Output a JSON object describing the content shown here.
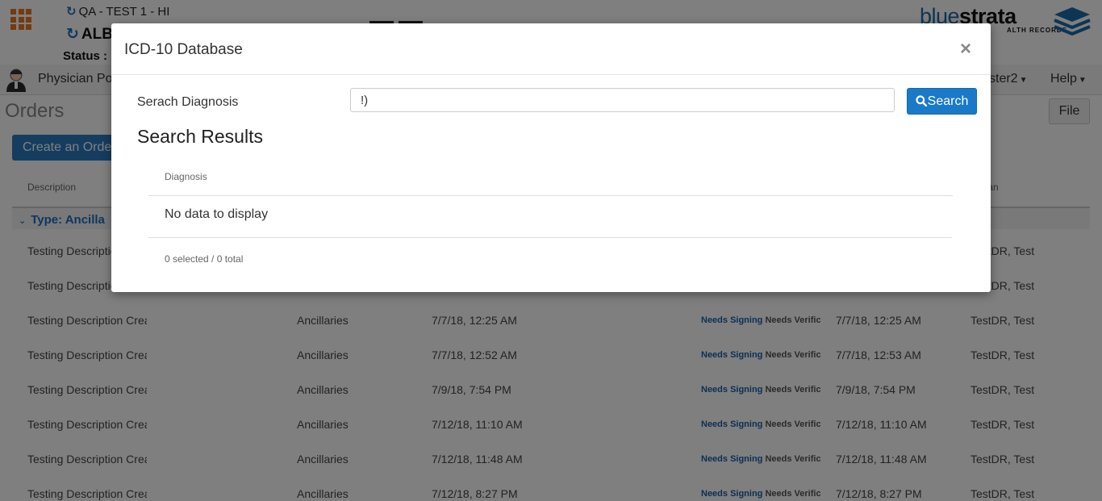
{
  "header": {
    "facility": "QA - TEST 1 - HI",
    "patient_name": "ALB",
    "status_label": "Status :",
    "logo": {
      "blue": "blue",
      "strata": "strata",
      "sub": "ALTH RECORDS"
    }
  },
  "nav": {
    "portal_label": "Physician Por",
    "user_label": "ster2",
    "help_label": "Help"
  },
  "page": {
    "title": "Orders",
    "file_button": "File",
    "create_button": "Create an Order"
  },
  "table": {
    "headers": {
      "description": "Description",
      "physician": "ician"
    },
    "group_label": "Type: Ancilla",
    "rows": [
      {
        "desc": "Testing Description Crea",
        "type": "",
        "date": "",
        "needs_signing": "",
        "needs_verify": "",
        "date2": "",
        "physician": "TestDR, Test"
      },
      {
        "desc": "Testing Description Crea",
        "type": "",
        "date": "",
        "needs_signing": "",
        "needs_verify": "",
        "date2": "",
        "physician": "TestDR, Test"
      },
      {
        "desc": "Testing Description Crea",
        "type": "Ancillaries",
        "date": "7/7/18, 12:25 AM",
        "needs_signing": "Needs Signing",
        "needs_verify": "Needs Verific",
        "date2": "7/7/18, 12:25 AM",
        "physician": "TestDR, Test"
      },
      {
        "desc": "Testing Description Crea",
        "type": "Ancillaries",
        "date": "7/7/18, 12:52 AM",
        "needs_signing": "Needs Signing",
        "needs_verify": "Needs Verific",
        "date2": "7/7/18, 12:53 AM",
        "physician": "TestDR, Test"
      },
      {
        "desc": "Testing Description Crea",
        "type": "Ancillaries",
        "date": "7/9/18, 7:54 PM",
        "needs_signing": "Needs Signing",
        "needs_verify": "Needs Verific",
        "date2": "7/9/18, 7:54 PM",
        "physician": "TestDR, Test"
      },
      {
        "desc": "Testing Description Crea",
        "type": "Ancillaries",
        "date": "7/12/18, 11:10 AM",
        "needs_signing": "Needs Signing",
        "needs_verify": "Needs Verific",
        "date2": "7/12/18, 11:10 AM",
        "physician": "TestDR, Test"
      },
      {
        "desc": "Testing Description Crea",
        "type": "Ancillaries",
        "date": "7/12/18, 11:48 AM",
        "needs_signing": "Needs Signing",
        "needs_verify": "Needs Verific",
        "date2": "7/12/18, 11:48 AM",
        "physician": "TestDR, Test"
      },
      {
        "desc": "Testing Description Crea",
        "type": "Ancillaries",
        "date": "7/12/18, 8:27 PM",
        "needs_signing": "Needs Signing",
        "needs_verify": "Needs Verific",
        "date2": "7/12/18, 8:27 PM",
        "physician": "TestDR, Test"
      }
    ]
  },
  "modal": {
    "title": "ICD-10 Database",
    "close_label": "×",
    "search_label": "Serach Diagnosis",
    "search_value": "!)",
    "search_button": "Search",
    "results_title": "Search Results",
    "results_header": "Diagnosis",
    "empty_message": "No data to display",
    "selection_summary": "0 selected / 0 total"
  },
  "colors": {
    "accent": "#1a7ac8",
    "brand_orange": "#e87722",
    "link_blue": "#1a6fc2"
  },
  "icons": {
    "apps": "grid-icon",
    "refresh": "refresh-icon",
    "search": "search-icon",
    "close": "close-icon",
    "avatar": "avatar-icon"
  }
}
